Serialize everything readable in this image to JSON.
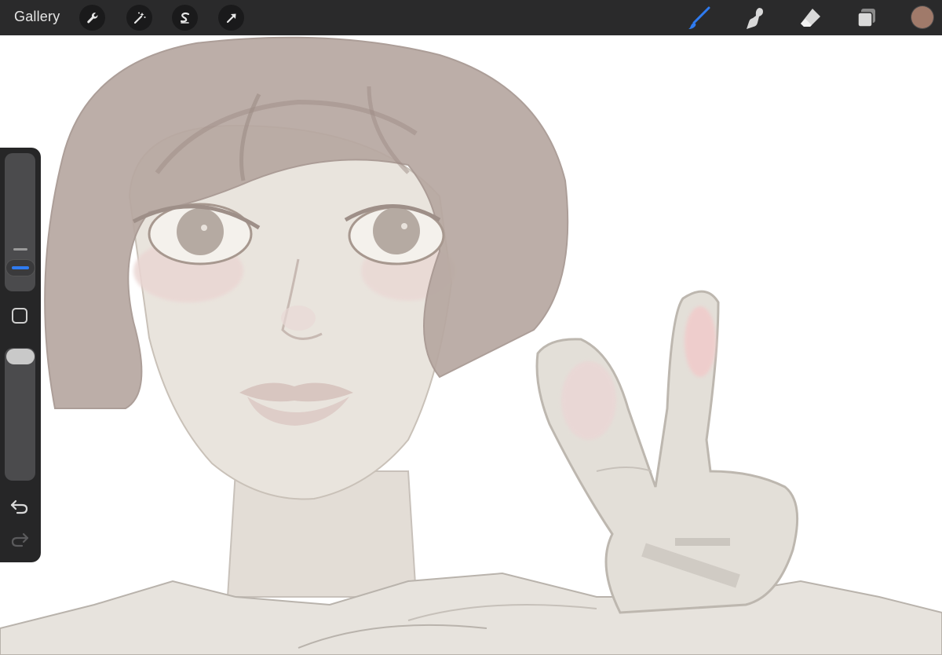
{
  "toolbar": {
    "gallery_label": "Gallery",
    "left_tools": [
      "wrench-icon",
      "magic-wand-icon",
      "selection-icon",
      "transform-arrow-icon"
    ],
    "right_tools": [
      "brush-icon",
      "smudge-icon",
      "eraser-icon",
      "layers-icon"
    ],
    "active_tool": "brush-icon",
    "accent_color": "#2f7bf0",
    "current_color": "#a07a6a"
  },
  "sidebar": {
    "brush_size_level": 0.52,
    "opacity_level": 0.08,
    "items": [
      "brush-size-slider",
      "modify-button",
      "opacity-slider",
      "undo-icon",
      "redo-icon"
    ],
    "redo_enabled": false
  },
  "canvas": {
    "subject": "sketch",
    "palette": {
      "hair": "#b9aaa3",
      "skin": "#e7e1da",
      "line": "#a9a29b",
      "blush": "#eccdcd"
    }
  }
}
